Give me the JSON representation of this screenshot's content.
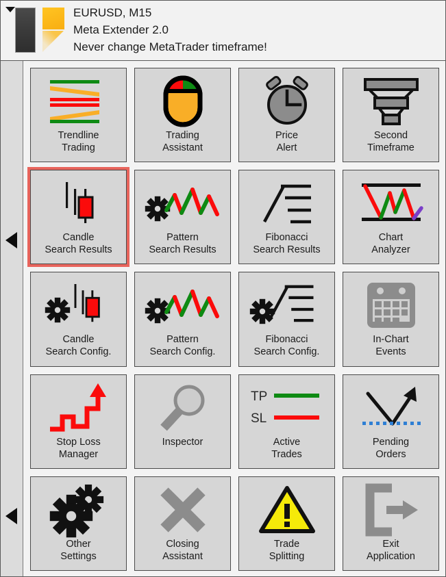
{
  "window": {
    "background": "#f3f3f3",
    "border_color": "#5a5a5a"
  },
  "header": {
    "collapse_caret": "caret-down-icon",
    "logo": "meta-extender-logo",
    "line1": "EURUSD, M15",
    "line2": "Meta Extender 2.0",
    "line3": "Never change MetaTrader timeframe!"
  },
  "side_rail": {
    "arrow_top": "previous-page-arrow",
    "arrow_bottom": "previous-page-arrow-2"
  },
  "theme": {
    "tile_background": "#d6d6d6",
    "tile_border": "#4a4a4a",
    "selection_border": "#e8645c",
    "green": "#0e8a13",
    "red": "#fb0b0b",
    "orange": "#f9ae27",
    "yellow": "#f5ea09",
    "gray_icon": "#8c8c8c",
    "purple": "#7a3ec8",
    "blue_dot": "#2f7fd4",
    "text": "#1b1b1b"
  },
  "grid": {
    "rows": [
      [
        {
          "label_line1": "Trendline",
          "label_line2": "Trading",
          "icon": "trendline-icon",
          "selected": false
        },
        {
          "label_line1": "Trading",
          "label_line2": "Assistant",
          "icon": "mouse-icon",
          "selected": false
        },
        {
          "label_line1": "Price",
          "label_line2": "Alert",
          "icon": "alarm-clock-icon",
          "selected": false
        },
        {
          "label_line1": "Second",
          "label_line2": "Timeframe",
          "icon": "funnel-timeframe-icon",
          "selected": false
        }
      ],
      [
        {
          "label_line1": "Candle",
          "label_line2": "Search Results",
          "icon": "candlestick-icon",
          "selected": true
        },
        {
          "label_line1": "Pattern",
          "label_line2": "Search Results",
          "icon": "zigzag-gear-icon",
          "selected": false
        },
        {
          "label_line1": "Fibonacci",
          "label_line2": "Search Results",
          "icon": "fibonacci-icon",
          "selected": false
        },
        {
          "label_line1": "Chart",
          "label_line2": "Analyzer",
          "icon": "chart-analyzer-icon",
          "selected": false
        }
      ],
      [
        {
          "label_line1": "Candle",
          "label_line2": "Search Config.",
          "icon": "candlestick-gear-icon",
          "selected": false
        },
        {
          "label_line1": "Pattern",
          "label_line2": "Search Config.",
          "icon": "zigzag-gear-icon",
          "selected": false
        },
        {
          "label_line1": "Fibonacci",
          "label_line2": "Search Config.",
          "icon": "fibonacci-gear-icon",
          "selected": false
        },
        {
          "label_line1": "In-Chart",
          "label_line2": "Events",
          "icon": "calendar-icon",
          "selected": false
        }
      ],
      [
        {
          "label_line1": "Stop Loss",
          "label_line2": "Manager",
          "icon": "stairs-arrow-icon",
          "selected": false
        },
        {
          "label_line1": "Inspector",
          "label_line2": "",
          "icon": "magnifier-icon",
          "selected": false
        },
        {
          "label_line1": "Active",
          "label_line2": "Trades",
          "icon": "tp-sl-icon",
          "selected": false
        },
        {
          "label_line1": "Pending",
          "label_line2": "Orders",
          "icon": "pending-order-icon",
          "selected": false
        }
      ],
      [
        {
          "label_line1": "Other",
          "label_line2": "Settings",
          "icon": "gears-icon",
          "selected": false
        },
        {
          "label_line1": "Closing",
          "label_line2": "Assistant",
          "icon": "x-close-icon",
          "selected": false
        },
        {
          "label_line1": "Trade",
          "label_line2": "Splitting",
          "icon": "warning-triangle-icon",
          "selected": false
        },
        {
          "label_line1": "Exit",
          "label_line2": "Application",
          "icon": "exit-icon",
          "selected": false
        }
      ]
    ]
  },
  "icon_text": {
    "tp": "TP",
    "sl": "SL"
  }
}
